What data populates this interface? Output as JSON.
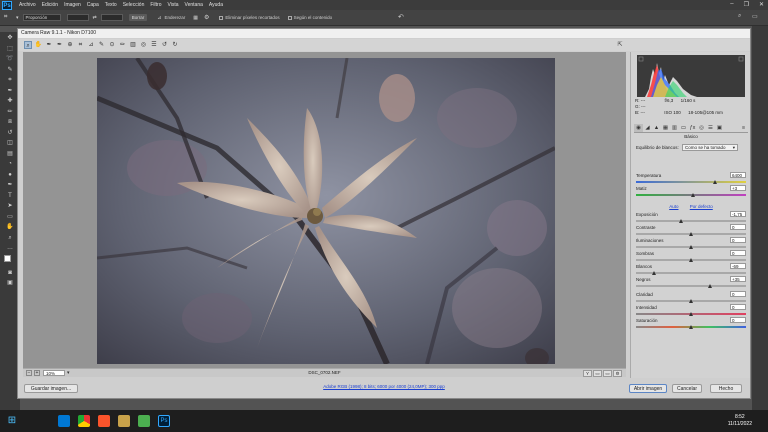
{
  "app": {
    "logo": "Ps",
    "menu": [
      "Archivo",
      "Edición",
      "Imagen",
      "Capa",
      "Texto",
      "Selección",
      "Filtro",
      "Vista",
      "Ventana",
      "Ayuda"
    ]
  },
  "options": {
    "preset": "Proporción",
    "clear_label": "Borrar",
    "straighten_label": "Enderezar",
    "delete_cropped": "Eliminar píxeles recortados",
    "content_aware": "Según el contenido"
  },
  "dialog": {
    "title": "Camera Raw 9.1.1 - Nikon D7100",
    "zoom": "10%",
    "filename": "DSC_0702.NEF",
    "workflow": "Adobe RGB (1998); 8 bits; 6000 por 4000 (24,0MP); 300 ppp",
    "save_label": "Guardar imagen...",
    "open_label": "Abrir imagen",
    "cancel_label": "Cancelar",
    "done_label": "Hecho",
    "view_buttons": [
      "Y",
      "▭",
      "▭",
      "⚙"
    ]
  },
  "camera": {
    "r_label": "R:",
    "g_label": "G:",
    "b_label": "B:",
    "r": "---",
    "g": "---",
    "b": "---",
    "aperture": "f/6,3",
    "shutter": "1/160 s",
    "iso": "ISO 100",
    "lens": "18-105@105 mm"
  },
  "panel": {
    "name": "Básico",
    "wb_label": "Equilibrio de blancos:",
    "wb_value": "Como se ha tomado",
    "auto": "Auto",
    "defaults": "Por defecto",
    "sliders_top": [
      {
        "label": "Temperatura",
        "value": "6400",
        "pos": 0.72
      },
      {
        "label": "Matiz",
        "value": "+3",
        "pos": 0.52
      }
    ],
    "sliders_tone": [
      {
        "label": "Exposición",
        "value": "-1,75",
        "pos": 0.41
      },
      {
        "label": "Contraste",
        "value": "0",
        "pos": 0.5
      },
      {
        "label": "Iluminaciones",
        "value": "0",
        "pos": 0.5
      },
      {
        "label": "Sombras",
        "value": "0",
        "pos": 0.5
      },
      {
        "label": "Blancos",
        "value": "-69",
        "pos": 0.16
      },
      {
        "label": "Negros",
        "value": "+35",
        "pos": 0.67
      }
    ],
    "sliders_presence": [
      {
        "label": "Claridad",
        "value": "0",
        "pos": 0.5
      },
      {
        "label": "Intensidad",
        "value": "0",
        "pos": 0.5
      },
      {
        "label": "Saturación",
        "value": "0",
        "pos": 0.5
      }
    ]
  },
  "clock": {
    "time": "8:52",
    "date": "11/11/2022"
  },
  "colors": {
    "accent": "#31a8ff",
    "link": "#1a3fd0"
  }
}
